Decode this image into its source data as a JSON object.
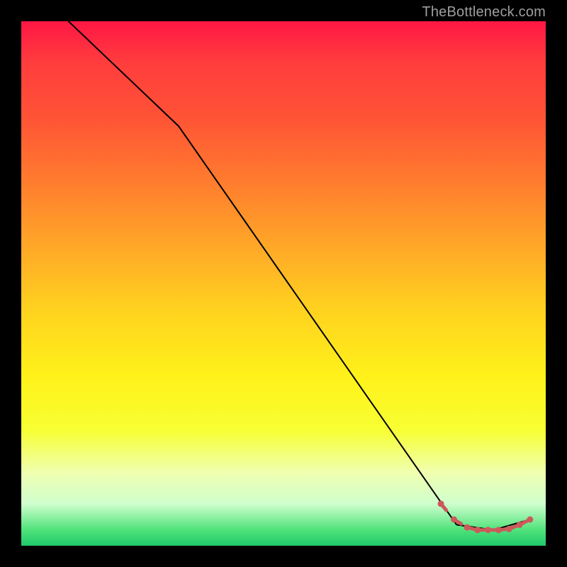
{
  "watermark": "TheBottleneck.com",
  "chart_data": {
    "type": "line",
    "title": "",
    "xlabel": "",
    "ylabel": "",
    "xlim": [
      0,
      100
    ],
    "ylim": [
      0,
      100
    ],
    "grid": false,
    "series": [
      {
        "name": "main-curve",
        "color": "#000000",
        "style": "solid",
        "x": [
          9,
          30,
          83,
          90,
          97
        ],
        "y": [
          100,
          80,
          4,
          3,
          5
        ]
      },
      {
        "name": "dashed-points",
        "color": "#cc5a5a",
        "style": "dashed-dots",
        "x": [
          80,
          82.5,
          85,
          87,
          89,
          91,
          93,
          95,
          97
        ],
        "y": [
          8,
          5,
          3.5,
          3,
          3,
          3,
          3.2,
          4,
          5
        ]
      }
    ],
    "colors": {
      "line": "#000000",
      "dots": "#cc5a5a",
      "gradient_top": "#ff1744",
      "gradient_bottom": "#1fc96a"
    }
  }
}
